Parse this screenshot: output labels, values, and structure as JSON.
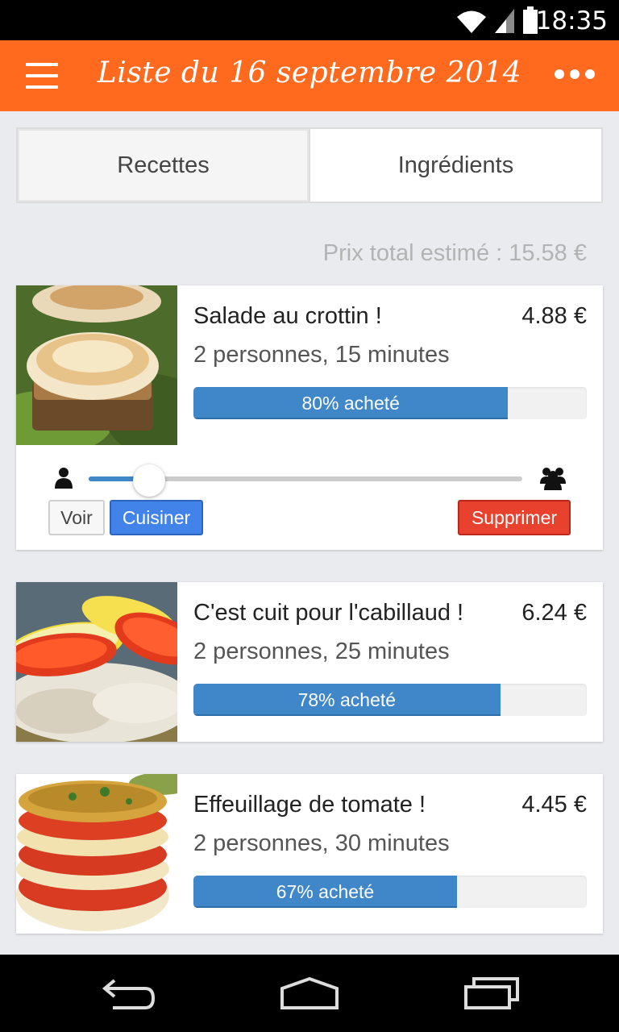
{
  "status": {
    "time": "18:35"
  },
  "appbar": {
    "title": "Liste du 16 septembre 2014"
  },
  "tabs": [
    {
      "label": "Recettes",
      "active": true
    },
    {
      "label": "Ingrédients",
      "active": false
    }
  ],
  "total_label": "Prix total estimé : 15.58 €",
  "recipes": [
    {
      "title": "Salade au crottin !",
      "price": "4.88 €",
      "meta": "2 personnes, 15 minutes",
      "progress_label": "80% acheté",
      "progress": 0.8,
      "image": "goat-cheese-salad"
    },
    {
      "title": "C'est cuit pour l'cabillaud !",
      "price": "6.24 €",
      "meta": "2 personnes, 25 minutes",
      "progress_label": "78% acheté",
      "progress": 0.78,
      "image": "cod-with-tomato-lemon"
    },
    {
      "title": "Effeuillage de tomate !",
      "price": "4.45 €",
      "meta": "2 personnes, 30 minutes",
      "progress_label": "67% acheté",
      "progress": 0.67,
      "image": "tomato-mille-feuille"
    }
  ],
  "expanded": {
    "slider_value": 0.14,
    "buttons": {
      "voir": "Voir",
      "cuisiner": "Cuisiner",
      "supprimer": "Supprimer"
    }
  },
  "colors": {
    "appbar": "#ff6a1f",
    "progress": "#3f87c9",
    "cuisiner": "#4183e8",
    "supprimer": "#e8422f"
  },
  "icons": [
    "wifi-icon",
    "signal-icon",
    "battery-icon",
    "menu-icon",
    "more-icon",
    "person-icon",
    "group-icon",
    "back-icon",
    "home-icon",
    "recents-icon"
  ]
}
